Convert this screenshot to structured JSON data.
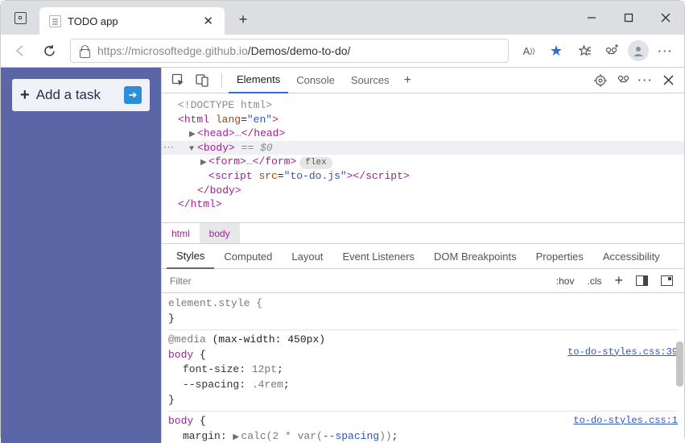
{
  "tab": {
    "title": "TODO app"
  },
  "url": {
    "prefix": "https://",
    "grey1": "microsoftedge.github.io",
    "dark": "/Demos/demo-to-do/",
    "placeholder": ""
  },
  "page": {
    "addTask": "Add a task"
  },
  "devtools": {
    "tabs": {
      "elements": "Elements",
      "console": "Console",
      "sources": "Sources"
    },
    "dom": {
      "doctype": "<!DOCTYPE html>",
      "htmlOpen": "html",
      "htmlLang": "lang",
      "htmlLangVal": "\"en\"",
      "head": "head",
      "ellipsis": "…",
      "body": "body",
      "eqSel": "== $0",
      "form": "form",
      "flex": "flex",
      "script": "script",
      "srcAttr": "src",
      "srcVal": "\"to-do.js\"",
      "bodyClose": "body",
      "htmlClose": "html"
    },
    "crumbs": {
      "html": "html",
      "body": "body"
    },
    "styleTabs": {
      "styles": "Styles",
      "computed": "Computed",
      "layout": "Layout",
      "events": "Event Listeners",
      "dom": "DOM Breakpoints",
      "props": "Properties",
      "a11y": "Accessibility"
    },
    "filter": {
      "placeholder": "Filter",
      "hov": ":hov",
      "cls": ".cls"
    },
    "rules": {
      "elementStyle": "element.style {",
      "mediaKw": "@media",
      "mediaQ": "(max-width: 450px)",
      "bodySel": "body",
      "fontSize": "font-size",
      "fontSizeVal": "12pt",
      "spacing": "--spacing",
      "spacingVal": ".4rem",
      "margin": "margin",
      "marginVal": "calc(2 * var(",
      "marginVar": "--spacing",
      "marginEnd": "))",
      "link1": "to-do-styles.css:39",
      "link2": "to-do-styles.css:1",
      "brace": "}"
    }
  }
}
